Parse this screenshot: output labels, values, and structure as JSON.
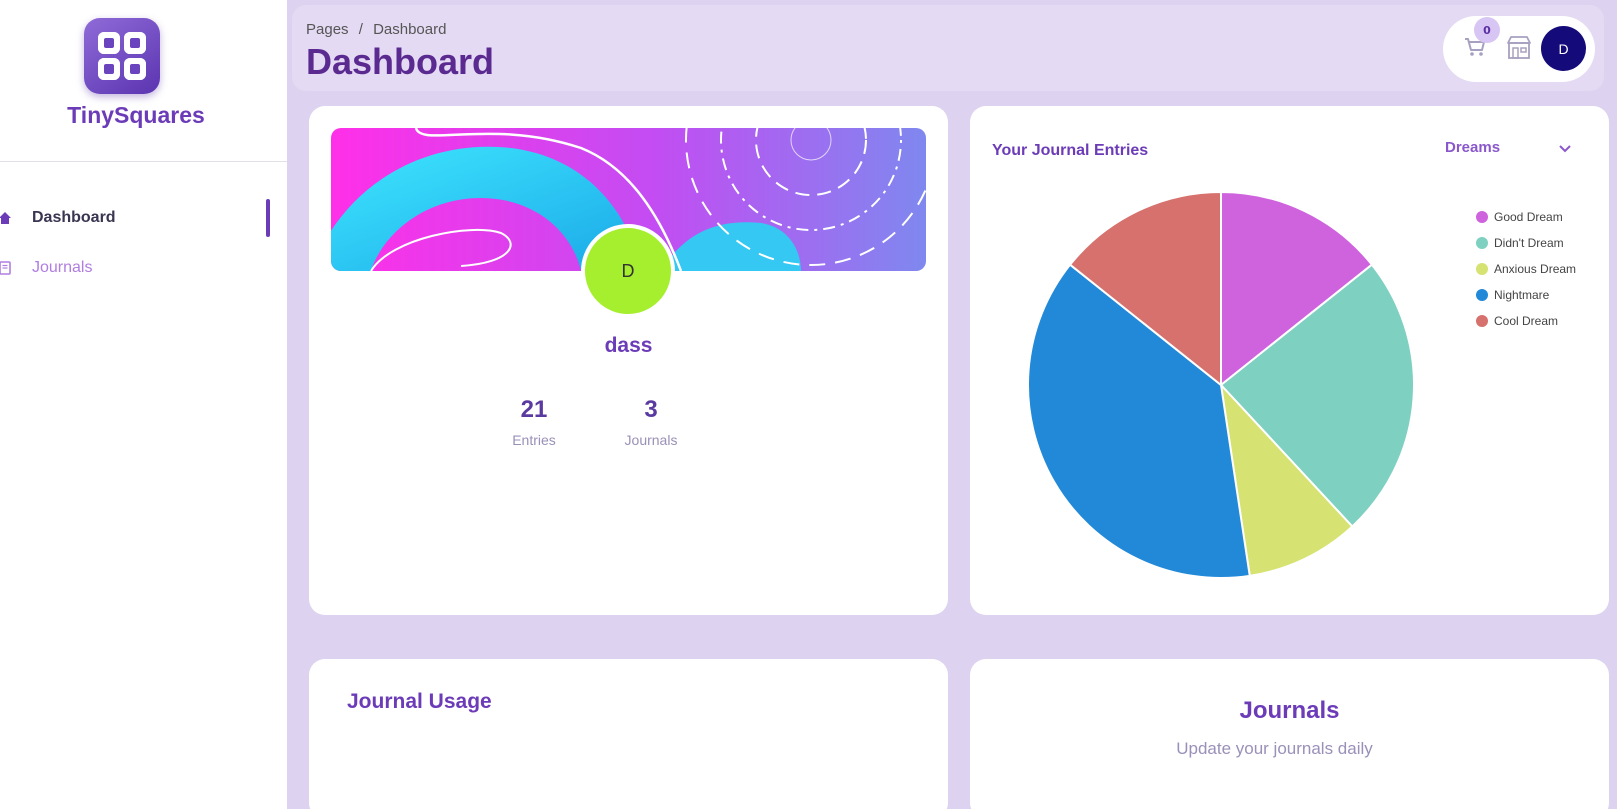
{
  "sidebar": {
    "brand": "TinySquares",
    "items": [
      {
        "label": "Dashboard",
        "icon": "home-icon",
        "active": true
      },
      {
        "label": "Journals",
        "icon": "book-icon",
        "active": false
      }
    ]
  },
  "header": {
    "breadcrumb_root": "Pages",
    "breadcrumb_sep": "/",
    "breadcrumb_current": "Dashboard",
    "title": "Dashboard",
    "cart_count": "0",
    "avatar_initial": "D"
  },
  "profile": {
    "avatar_initial": "D",
    "username": "dass",
    "stats": [
      {
        "value": "21",
        "label": "Entries"
      },
      {
        "value": "3",
        "label": "Journals"
      }
    ]
  },
  "chart_card": {
    "title": "Your Journal Entries",
    "select_value": "Dreams"
  },
  "chart_data": {
    "type": "pie",
    "title": "Your Journal Entries",
    "legend_position": "top-right",
    "categories": [
      "Good Dream",
      "Didn't Dream",
      "Anxious Dream",
      "Nightmare",
      "Cool Dream"
    ],
    "values": [
      3,
      5,
      2,
      8,
      3
    ],
    "colors": [
      "#cf63de",
      "#7ed0c0",
      "#d6e271",
      "#2289d8",
      "#d6716e"
    ]
  },
  "usage_card": {
    "title": "Journal Usage"
  },
  "journals_card": {
    "title": "Journals",
    "subtitle": "Update your journals daily"
  },
  "colors": {
    "accent": "#6c3cb8",
    "background": "#ddd2ef",
    "avatar_dark": "#140a7a",
    "avatar_green": "#a6ef2f"
  }
}
